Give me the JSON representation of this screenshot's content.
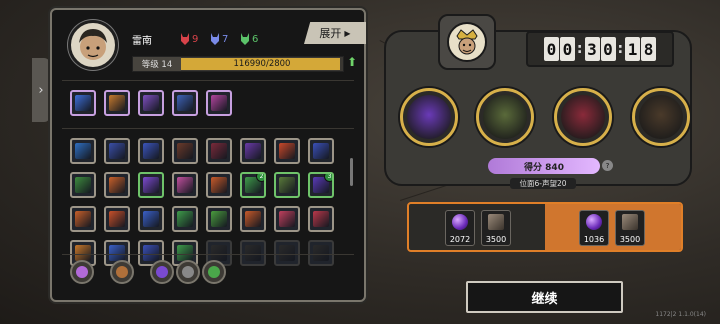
{
  "player": {
    "name": "雷南",
    "level_label": "等级 14",
    "xp_text": "116990/2800",
    "xp_fraction": 0.98
  },
  "resources": [
    {
      "icon": "red-fox-mask-icon",
      "color": "#d8434a",
      "count": "9"
    },
    {
      "icon": "blue-fox-mask-icon",
      "color": "#7a8be8",
      "count": "7"
    },
    {
      "icon": "green-fox-mask-icon",
      "color": "#5cc46a",
      "count": "6"
    }
  ],
  "expand_label": "展开",
  "timer": {
    "digits": [
      "0",
      "0",
      "3",
      "0",
      "1",
      "8"
    ]
  },
  "score_text": "得分 840",
  "rank_text": "位面6-声望20",
  "rewards_left": [
    {
      "icon": "purple-orb-icon",
      "value": "2072"
    },
    {
      "icon": "dark-ingot-icon",
      "value": "3500"
    }
  ],
  "rewards_right": [
    {
      "icon": "purple-orb-icon",
      "value": "1036"
    },
    {
      "icon": "dark-ingot-icon",
      "value": "3500"
    }
  ],
  "continue_label": "继续",
  "version": "1172|2 1.1.0(14)",
  "equipped_skills": [
    {
      "icon": "lightning-fist-icon",
      "color": "#3d6fd8"
    },
    {
      "icon": "treasure-chest-icon",
      "color": "#c67a2e"
    },
    {
      "icon": "robot-face-icon",
      "color": "#7d4fbf"
    },
    {
      "icon": "storm-slash-icon",
      "color": "#3e63b8"
    },
    {
      "icon": "venom-flower-icon",
      "color": "#b2459e"
    }
  ],
  "skill_grid": [
    [
      {
        "icon": "blue-blade-icon",
        "color": "#2f6fc1"
      },
      {
        "icon": "frost-sword-icon",
        "color": "#3a4fa8"
      },
      {
        "icon": "arcane-burst-icon",
        "color": "#3b55bc"
      },
      {
        "icon": "dark-rune-icon",
        "color": "#6b3a2a"
      },
      {
        "icon": "blood-claw-icon",
        "color": "#7a2a3a"
      },
      {
        "icon": "shadow-scythe-icon",
        "color": "#6a3aa8"
      },
      {
        "icon": "fire-beam-icon",
        "color": "#c8482a"
      },
      {
        "icon": "lightning-net-icon",
        "color": "#3a50b8"
      }
    ],
    [
      {
        "icon": "green-chevron-icon",
        "color": "#3e8c3e"
      },
      {
        "icon": "flame-feather-icon",
        "color": "#c8602a"
      },
      {
        "icon": "violet-blade-icon",
        "color": "#7c4ad0"
      },
      {
        "icon": "pink-crystal-icon",
        "color": "#c0509e"
      },
      {
        "icon": "ember-stone-icon",
        "color": "#c85a2a"
      },
      {
        "icon": "emerald-shards-icon",
        "color": "#3e9c4a",
        "badge": "2"
      },
      {
        "icon": "barrier-grid-icon",
        "color": "#5a7a3a"
      },
      {
        "icon": "void-wing-icon",
        "color": "#5a3ab8",
        "badge": "3"
      }
    ],
    [
      {
        "icon": "orange-slash-icon",
        "color": "#c8602a"
      },
      {
        "icon": "ring-link-icon",
        "color": "#c8502a"
      },
      {
        "icon": "ice-lance-icon",
        "color": "#3a60c8"
      },
      {
        "icon": "green-sigil-icon",
        "color": "#3e9c4a"
      },
      {
        "icon": "leaf-dagger-icon",
        "color": "#4a9c3e"
      },
      {
        "icon": "flame-arrow-icon",
        "color": "#c85a2a"
      },
      {
        "icon": "pink-spear-icon",
        "color": "#c0405e"
      },
      {
        "icon": "blade-fan-icon",
        "color": "#b8384a"
      }
    ],
    [
      {
        "icon": "amber-orb-icon",
        "color": "#c8782a"
      },
      {
        "icon": "azure-eye-icon",
        "color": "#3a60c8"
      },
      {
        "icon": "frost-rune-icon",
        "color": "#3a50b8"
      },
      {
        "icon": "jade-gem-icon",
        "color": "#3e9c4a"
      },
      {
        "icon": "empty-slot-icon",
        "color": "#2a2a2a"
      },
      {
        "icon": "empty-slot-icon",
        "color": "#2a2a2a"
      },
      {
        "icon": "empty-slot-icon",
        "color": "#2a2a2a"
      },
      {
        "icon": "empty-slot-icon",
        "color": "#2a2a2a"
      }
    ]
  ],
  "filters": [
    {
      "icon": "purple-pot-icon",
      "color": "#b26ad8"
    },
    {
      "icon": "bronze-coin-icon",
      "color": "#b0703a"
    },
    {
      "icon": "violet-gear-icon",
      "color": "#7a4ad0"
    },
    {
      "icon": "grey-shard-icon",
      "color": "#888888"
    },
    {
      "icon": "green-drop-icon",
      "color": "#4aa84a"
    }
  ],
  "heroes": [
    {
      "icon": "purple-blade-hero-icon",
      "color": "#6a3ab8"
    },
    {
      "icon": "serpent-hero-icon",
      "color": "#5a6a3a"
    },
    {
      "icon": "crimson-mask-hero-icon",
      "color": "#8a2a3a"
    },
    {
      "icon": "glasses-kid-hero-icon",
      "color": "#4a3a2a"
    }
  ]
}
